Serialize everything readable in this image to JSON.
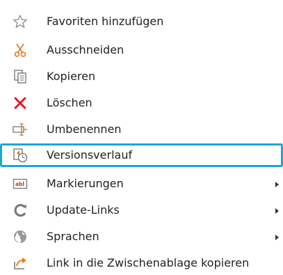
{
  "menu": {
    "items": [
      {
        "label": "Favoriten hinzufügen",
        "icon": "star-outline-icon"
      },
      {
        "label": "Ausschneiden",
        "icon": "scissors-icon"
      },
      {
        "label": "Kopieren",
        "icon": "copy-icon"
      },
      {
        "label": "Löschen",
        "icon": "delete-x-icon"
      },
      {
        "label": "Umbenennen",
        "icon": "rename-icon"
      },
      {
        "label": "Versionsverlauf",
        "icon": "version-history-icon"
      },
      {
        "label": "Markierungen",
        "icon": "tag-abl-icon"
      },
      {
        "label": "Update-Links",
        "icon": "refresh-icon"
      },
      {
        "label": "Sprachen",
        "icon": "globe-icon"
      },
      {
        "label": "Link in die Zwischenablage kopieren",
        "icon": "share-link-icon"
      }
    ],
    "selected_label": "Versionsverlauf",
    "icon_texts": {
      "tag": "abl"
    }
  },
  "colors": {
    "selection_border": "#19a6d6",
    "delete_red": "#e81123",
    "scissors_orange": "#e07a1f",
    "icon_gray": "#777777",
    "text": "#222222"
  }
}
